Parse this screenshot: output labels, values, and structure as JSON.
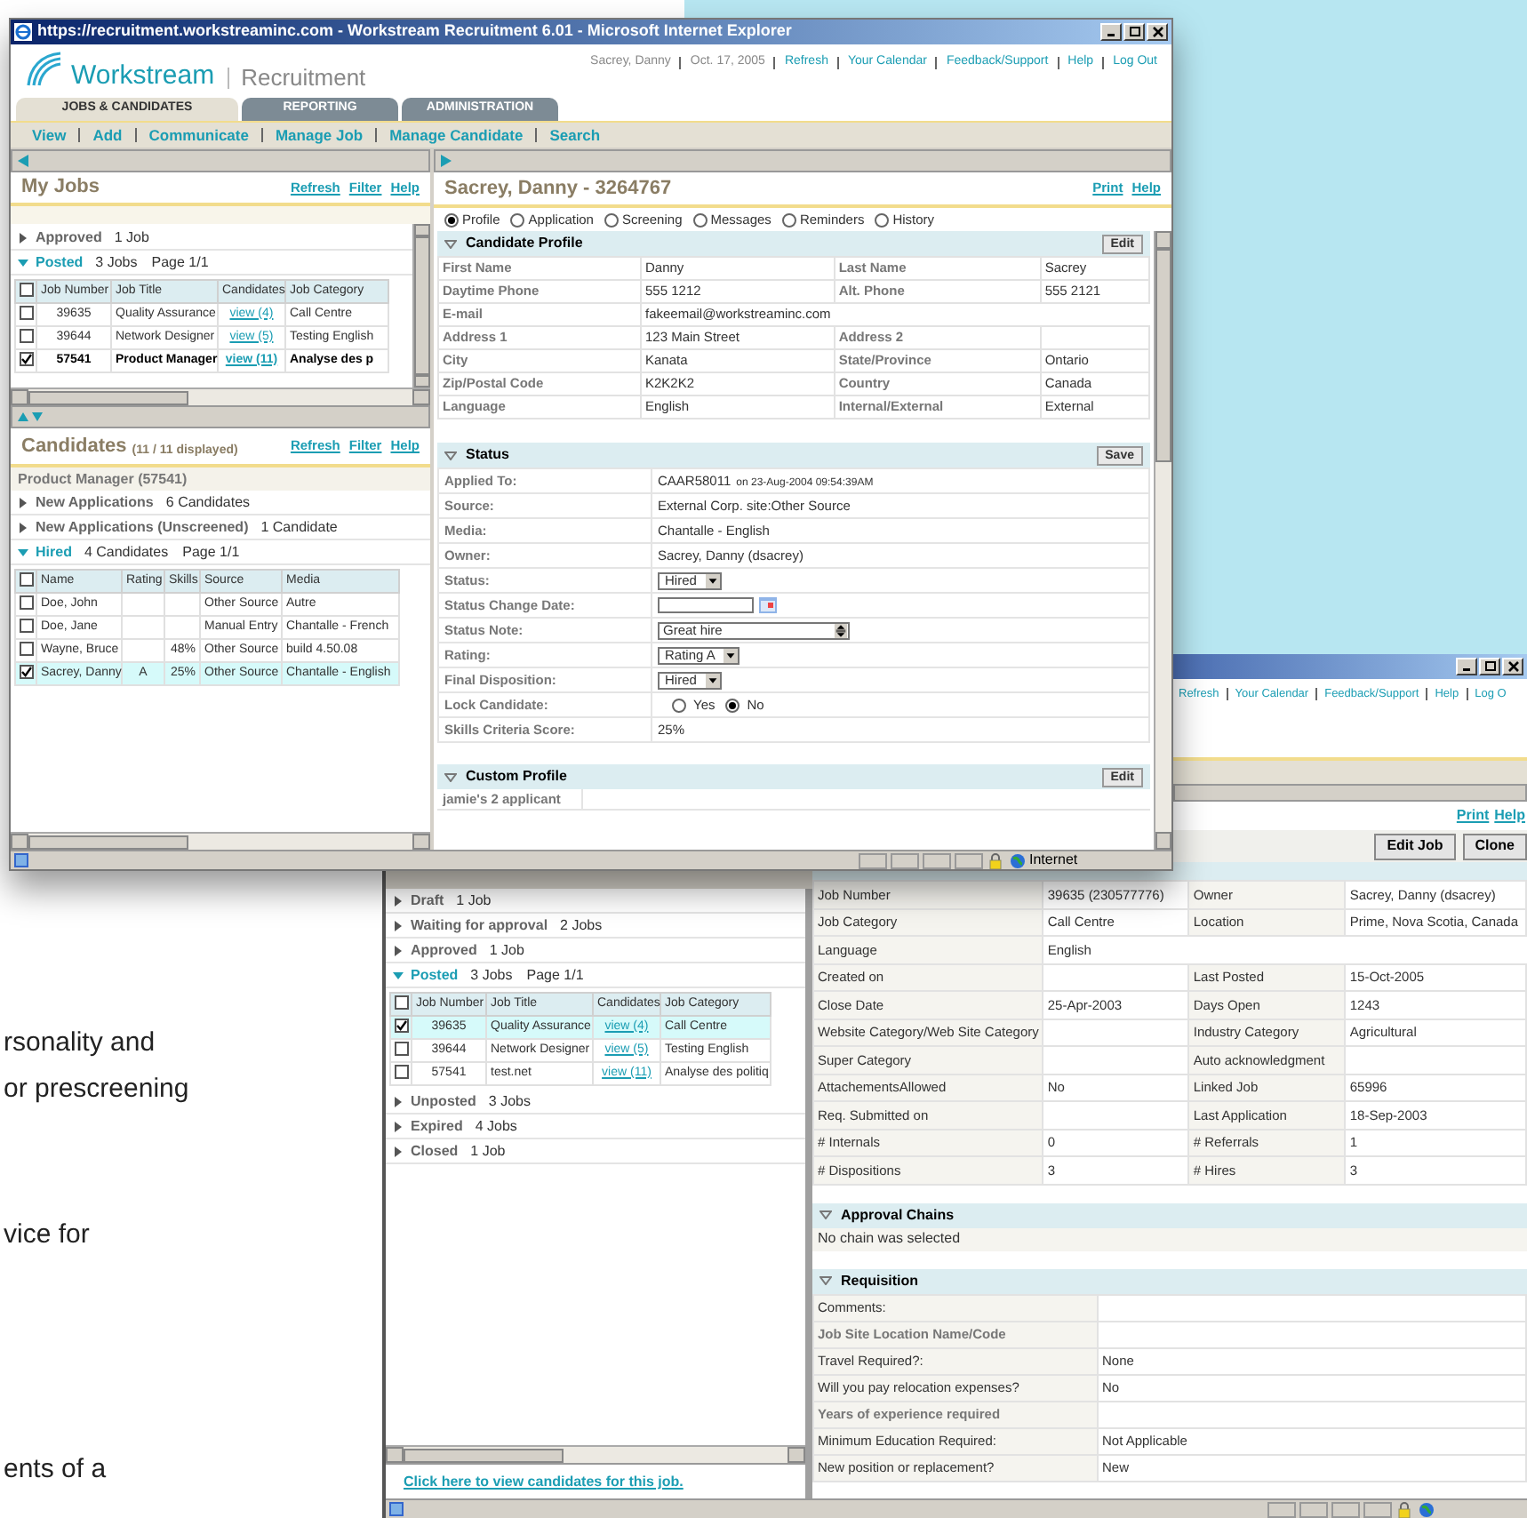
{
  "page_text": [
    [
      "rsonality and",
      "or prescreening"
    ],
    [
      "vice for"
    ],
    [
      "ents of a"
    ]
  ],
  "back_window": {
    "header_links": [
      "Refresh",
      "Your Calendar",
      "Feedback/Support",
      "Help",
      "Log O"
    ],
    "jobs": {
      "groups": [
        {
          "label": "Draft",
          "count": "1 Job",
          "expanded": false
        },
        {
          "label": "Waiting for approval",
          "count": "2 Jobs",
          "expanded": false
        },
        {
          "label": "Approved",
          "count": "1 Job",
          "expanded": false
        },
        {
          "label": "Posted",
          "count": "3 Jobs",
          "page": "Page 1/1",
          "expanded": true
        },
        {
          "label": "Unposted",
          "count": "3 Jobs",
          "expanded": false
        },
        {
          "label": "Expired",
          "count": "4 Jobs",
          "expanded": false
        },
        {
          "label": "Closed",
          "count": "1 Job",
          "expanded": false
        }
      ],
      "table": {
        "all_checked": false,
        "columns": [
          {
            "label": "Job Number",
            "kind": "center"
          },
          {
            "label": "Job Title",
            "kind": "text"
          },
          {
            "label": "Candidates",
            "kind": "link"
          },
          {
            "label": "Job Category",
            "kind": "text"
          }
        ],
        "rows": [
          {
            "checked": true,
            "selected": true,
            "current": false,
            "number": "39635",
            "title": "Quality Assurance",
            "candidates": "view (4)",
            "category": "Call Centre"
          },
          {
            "checked": false,
            "selected": false,
            "current": false,
            "number": "39644",
            "title": "Network Designer",
            "candidates": "view (5)",
            "category": "Testing English"
          },
          {
            "checked": false,
            "selected": false,
            "current": false,
            "number": "57541",
            "title": "test.net",
            "candidates": "view (11)",
            "category": "Analyse des politiq"
          }
        ]
      },
      "footer_link": "Click here to view candidates for this job."
    },
    "links": [
      "Print",
      "Help"
    ],
    "buttons": [
      "Edit Job",
      "Clone"
    ],
    "summary": [
      {
        "label": "Job Number",
        "value": "39635   (230577776)",
        "label2": "Owner",
        "value2": "Sacrey, Danny (dsacrey)"
      },
      {
        "label": "Job Category",
        "value": "Call Centre",
        "label2": "Location",
        "value2": "Prime, Nova Scotia, Canada"
      },
      {
        "label": "Language",
        "value": "English"
      },
      {
        "label": "Created on",
        "label2": "Last Posted",
        "value2": "15-Oct-2005"
      },
      {
        "label": "Close Date",
        "value": "25-Apr-2003",
        "label2": "Days Open",
        "value2": "1243"
      },
      {
        "label": "Website Category/Web Site Category",
        "label2": "Industry Category",
        "value2": "Agricultural"
      },
      {
        "label": "Super Category",
        "label2": "Auto acknowledgment"
      },
      {
        "label": "AttachementsAllowed",
        "value": "No",
        "label2": "Linked Job",
        "value2": "65996"
      },
      {
        "label": "Req. Submitted on",
        "label2": "Last Application",
        "value2": "18-Sep-2003"
      },
      {
        "label": "# Internals",
        "value": "0",
        "label2": "# Referrals",
        "value2": "1"
      },
      {
        "label": "# Dispositions",
        "value": "3",
        "label2": "# Hires",
        "value2": "3"
      }
    ],
    "approval": {
      "title": "Approval Chains",
      "text": "No chain was selected"
    },
    "requisition": {
      "title": "Requisition",
      "rows": [
        {
          "label": "Comments:",
          "kind": "plain"
        },
        {
          "label": "Job Site Location Name/Code",
          "kind": "bold"
        },
        {
          "label": "Travel Required?:",
          "value": "None",
          "kind": "plain"
        },
        {
          "label": "Will you pay relocation expenses?",
          "value": "No",
          "kind": "plain"
        },
        {
          "label": "Years of experience required",
          "kind": "bold"
        },
        {
          "label": "Minimum Education Required:",
          "value": "Not Applicable",
          "kind": "plain"
        },
        {
          "label": "New position or replacement?",
          "value": "New",
          "kind": "plain"
        }
      ]
    }
  },
  "front_window": {
    "title": "https://recruitment.workstreaminc.com - Workstream Recruitment 6.01 - Microsoft Internet Explorer",
    "logo": {
      "brand": "Workstream",
      "product": "Recruitment"
    },
    "user_bar": [
      {
        "label": "Sacrey, Danny",
        "kind": "text"
      },
      {
        "label": "Oct. 17, 2005",
        "kind": "text"
      },
      {
        "label": "Refresh",
        "kind": "link"
      },
      {
        "label": "Your Calendar",
        "kind": "link"
      },
      {
        "label": "Feedback/Support",
        "kind": "link"
      },
      {
        "label": "Help",
        "kind": "link"
      },
      {
        "label": "Log Out",
        "kind": "link"
      }
    ],
    "tabs": [
      {
        "label": "JOBS & CANDIDATES",
        "selected": true
      },
      {
        "label": "REPORTING",
        "selected": false
      },
      {
        "label": "ADMINISTRATION",
        "selected": false
      }
    ],
    "nav": [
      "View",
      "Add",
      "Communicate",
      "Manage Job",
      "Manage Candidate",
      "Search"
    ],
    "my_jobs": {
      "title": "My Jobs",
      "links": [
        "Refresh",
        "Filter",
        "Help"
      ],
      "groups": [
        {
          "label": "Approved",
          "count": "1 Job",
          "expanded": false
        },
        {
          "label": "Posted",
          "count": "3 Jobs",
          "page": "Page 1/1",
          "expanded": true
        }
      ],
      "table": {
        "all_checked": false,
        "columns": [
          {
            "label": "Job Number",
            "kind": "center"
          },
          {
            "label": "Job Title",
            "kind": "text"
          },
          {
            "label": "Candidates",
            "kind": "link"
          },
          {
            "label": "Job Category",
            "kind": "text"
          }
        ],
        "rows": [
          {
            "checked": false,
            "selected": false,
            "current": false,
            "number": "39635",
            "title": "Quality Assurance",
            "candidates": "view (4)",
            "category": "Call Centre"
          },
          {
            "checked": false,
            "selected": false,
            "current": false,
            "number": "39644",
            "title": "Network Designer",
            "candidates": "view (5)",
            "category": "Testing English"
          },
          {
            "checked": true,
            "selected": false,
            "current": true,
            "number": "57541",
            "title": "Product Manager",
            "candidates": "view (11)",
            "category": "Analyse des p"
          }
        ]
      }
    },
    "candidates": {
      "title": "Candidates",
      "count": "(11 / 11 displayed)",
      "links": [
        "Refresh",
        "Filter",
        "Help"
      ],
      "job": "Product Manager (57541)",
      "groups": [
        {
          "label": "New Applications",
          "count": "6 Candidates",
          "expanded": false
        },
        {
          "label": "New Applications (Unscreened)",
          "count": "1 Candidate",
          "expanded": false
        },
        {
          "label": "Hired",
          "count": "4 Candidates",
          "page": "Page 1/1",
          "expanded": true
        }
      ],
      "table": {
        "all_checked": false,
        "columns": [
          {
            "label": "Name",
            "kind": "text"
          },
          {
            "label": "Rating",
            "kind": "center"
          },
          {
            "label": "Skills",
            "kind": "number"
          },
          {
            "label": "Source",
            "kind": "text"
          },
          {
            "label": "Media",
            "kind": "text"
          }
        ],
        "rows": [
          {
            "checked": false,
            "selected": false,
            "current": false,
            "name": "Doe, John",
            "source": "Other Source",
            "media": "Autre"
          },
          {
            "checked": false,
            "selected": false,
            "current": false,
            "name": "Doe, Jane",
            "source": "Manual Entry",
            "media": "Chantalle - French"
          },
          {
            "checked": false,
            "selected": false,
            "current": false,
            "name": "Wayne, Bruce",
            "skills": "48%",
            "source": "Other Source",
            "media": "build 4.50.08"
          },
          {
            "checked": true,
            "selected": true,
            "current": false,
            "name": "Sacrey, Danny",
            "rating": "A",
            "skills": "25%",
            "source": "Other Source",
            "media": "Chantalle - English"
          }
        ]
      }
    },
    "candidate": {
      "title": "Sacrey, Danny - 3264767",
      "links": [
        "Print",
        "Help"
      ],
      "views": [
        {
          "label": "Profile",
          "selected": true
        },
        {
          "label": "Application",
          "selected": false
        },
        {
          "label": "Screening",
          "selected": false
        },
        {
          "label": "Messages",
          "selected": false
        },
        {
          "label": "Reminders",
          "selected": false
        },
        {
          "label": "History",
          "selected": false
        }
      ],
      "profile": {
        "title": "Candidate Profile",
        "button": "Edit",
        "rows": [
          {
            "label": "First Name",
            "value": "Danny",
            "label2": "Last Name",
            "value2": "Sacrey"
          },
          {
            "label": "Daytime Phone",
            "value": "555 1212",
            "label2": "Alt. Phone",
            "value2": "555 2121"
          },
          {
            "label": "E-mail",
            "value": "fakeemail@workstreaminc.com"
          },
          {
            "label": "Address 1",
            "value": "123 Main Street",
            "label2": "Address 2"
          },
          {
            "label": "City",
            "value": "Kanata",
            "label2": "State/Province",
            "value2": "Ontario"
          },
          {
            "label": "Zip/Postal Code",
            "value": "K2K2K2",
            "label2": "Country",
            "value2": "Canada"
          },
          {
            "label": "Language",
            "value": "English",
            "label2": "Internal/External",
            "value2": "External"
          }
        ]
      },
      "status": {
        "title": "Status",
        "button": "Save",
        "rows": [
          {
            "label": "Applied To:",
            "kind": "text",
            "value": "CAAR58011",
            "note": "on 23-Aug-2004  09:54:39AM"
          },
          {
            "label": "Source:",
            "kind": "text",
            "value": "External Corp. site:Other Source"
          },
          {
            "label": "Media:",
            "kind": "text",
            "value": "Chantalle - English"
          },
          {
            "label": "Owner:",
            "kind": "text",
            "value": "Sacrey, Danny (dsacrey)"
          },
          {
            "label": "Status:",
            "kind": "select",
            "value": "Hired"
          },
          {
            "label": "Status Change Date:",
            "kind": "date"
          },
          {
            "label": "Status Note:",
            "kind": "note",
            "value": "Great hire"
          },
          {
            "label": "Rating:",
            "kind": "select",
            "value": "Rating A"
          },
          {
            "label": "Final Disposition:",
            "kind": "select",
            "value": "Hired"
          },
          {
            "label": "Lock Candidate:",
            "kind": "radio",
            "options": [
              {
                "label": "Yes",
                "selected": false
              },
              {
                "label": "No",
                "selected": true
              }
            ]
          },
          {
            "label": "Skills Criteria Score:",
            "kind": "text",
            "value": "25%"
          }
        ]
      },
      "custom": {
        "title": "Custom Profile",
        "button": "Edit",
        "rows": [
          "jamie's 2 applicant"
        ]
      }
    },
    "status_bar": "Internet"
  }
}
